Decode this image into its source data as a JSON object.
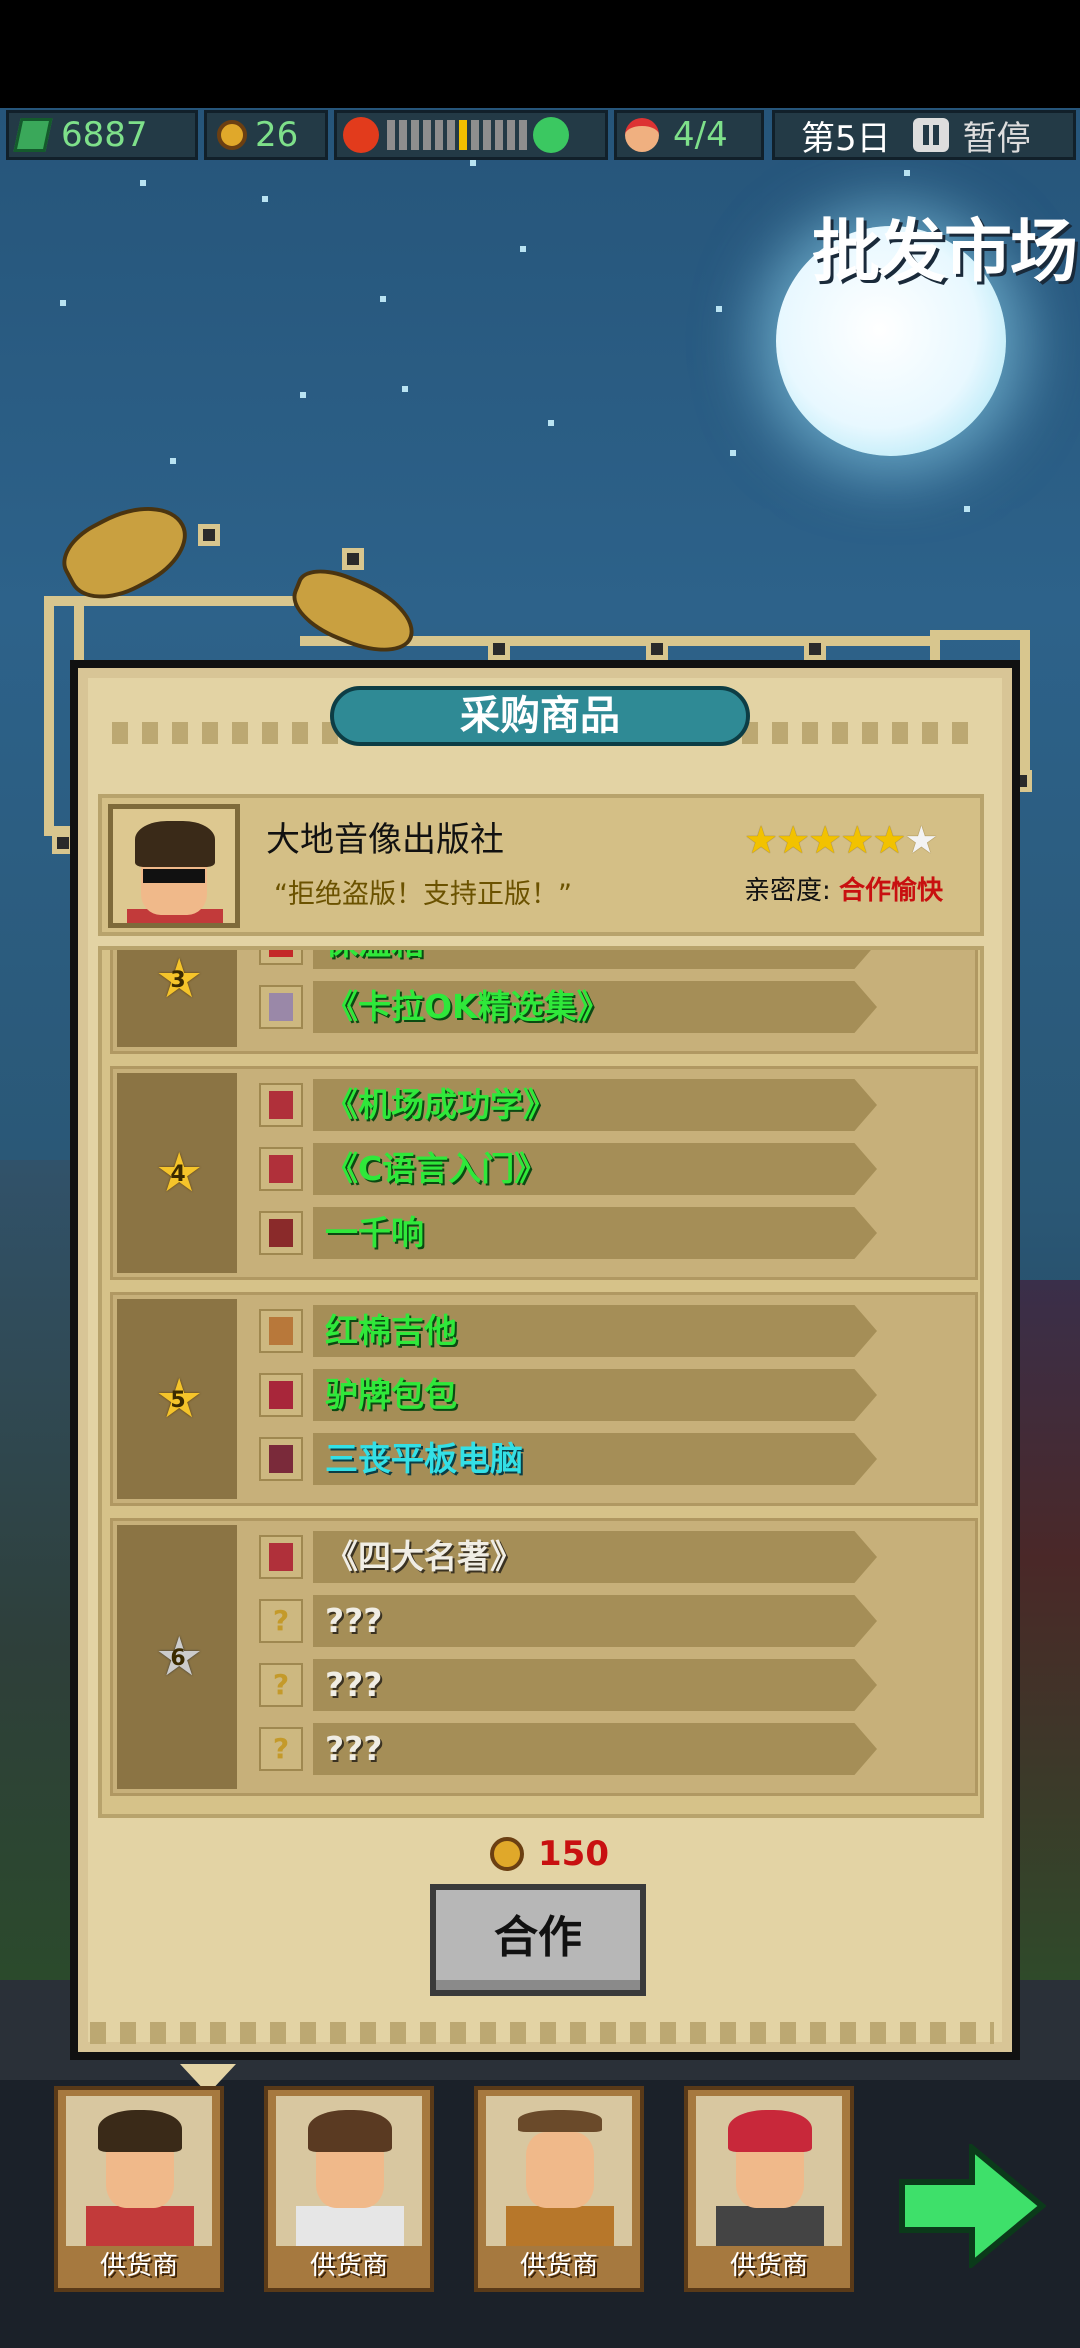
{
  "hud": {
    "money": "6887",
    "coins": "26",
    "mood_level": 0.55,
    "staff": "4/4",
    "day": "第5日",
    "pause_label": "暂停"
  },
  "location": "批发市场",
  "panel": {
    "title": "采购商品",
    "supplier": {
      "name": "大地音像出版社",
      "quote": "“拒绝盗版！支持正版！”",
      "stars": 5,
      "max_stars": 6,
      "affinity_label": "亲密度:",
      "affinity_value": "合作愉快"
    },
    "groups": [
      {
        "level": "3",
        "items": [
          {
            "name": "保温箱",
            "color": "#2fe83a",
            "icon": "red-box-icon"
          },
          {
            "name": "《卡拉OK精选集》",
            "color": "#2fe83a",
            "icon": "cd-icon"
          }
        ]
      },
      {
        "level": "4",
        "items": [
          {
            "name": "《机场成功学》",
            "color": "#2fe83a",
            "icon": "book-icon"
          },
          {
            "name": "《C语言入门》",
            "color": "#2fe83a",
            "icon": "book-icon"
          },
          {
            "name": "一千响",
            "color": "#2fe83a",
            "icon": "firecracker-icon"
          }
        ]
      },
      {
        "level": "5",
        "items": [
          {
            "name": "红棉吉他",
            "color": "#2fe83a",
            "icon": "guitar-icon"
          },
          {
            "name": "驴牌包包",
            "color": "#2fe83a",
            "icon": "bag-icon"
          },
          {
            "name": "三丧平板电脑",
            "color": "#33e0e6",
            "icon": "tablet-icon"
          }
        ]
      },
      {
        "level": "6",
        "items": [
          {
            "name": "《四大名著》",
            "color": "#f0ede4",
            "icon": "book-icon"
          },
          {
            "name": "???",
            "color": "#f0ede4",
            "icon": "question-icon"
          },
          {
            "name": "???",
            "color": "#f0ede4",
            "icon": "question-icon"
          },
          {
            "name": "???",
            "color": "#f0ede4",
            "icon": "question-icon"
          }
        ]
      }
    ],
    "cost": "150",
    "cooperate_label": "合作"
  },
  "suppliers_bar": [
    {
      "label": "供货商"
    },
    {
      "label": "供货商"
    },
    {
      "label": "供货商"
    },
    {
      "label": "供货商"
    }
  ]
}
